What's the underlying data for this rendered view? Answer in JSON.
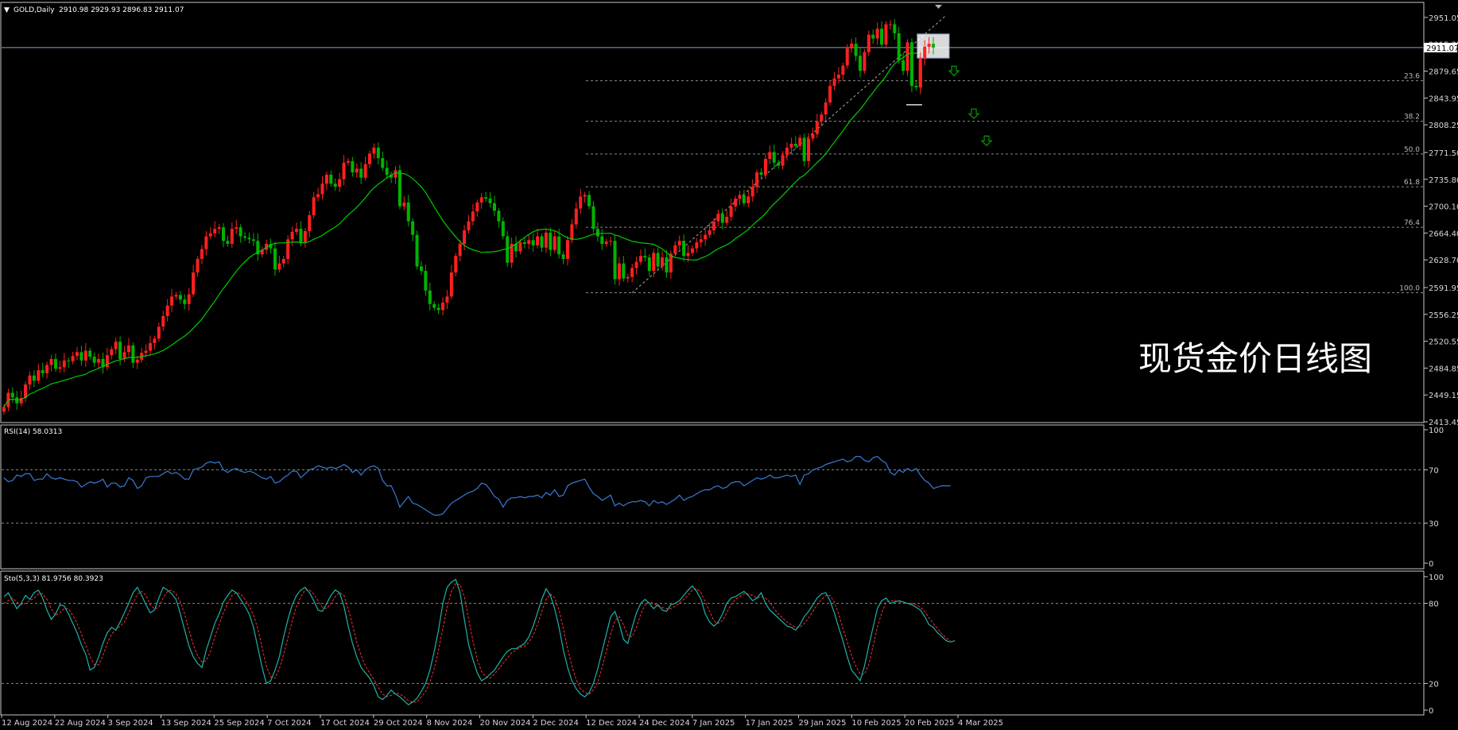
{
  "header": {
    "symbol": "GOLD,Daily",
    "ohlc": "2910.98 2929.93 2896.83 2911.07",
    "current_price": "2911.07"
  },
  "colors": {
    "background": "#000000",
    "up_candle": "#ff2020",
    "down_candle": "#00b400",
    "ma_line": "#00cc00",
    "rsi_line": "#3a7bd5",
    "sto_main": "#20b2aa",
    "sto_signal": "#ff3030",
    "grid_dotted": "#8a8a8a",
    "arrow": "#00a000"
  },
  "watermark": "现货金价日线图",
  "chart_data": [
    {
      "type": "candlestick",
      "title": "GOLD,Daily",
      "ylim": [
        2413.45,
        2970
      ],
      "y_ticks": [
        "2951.05",
        "2915.35",
        "2879.65",
        "2843.95",
        "2808.25",
        "2771.50",
        "2735.80",
        "2700.10",
        "2664.40",
        "2628.70",
        "2591.95",
        "2556.25",
        "2520.55",
        "2484.85",
        "2449.15",
        "2413.45"
      ],
      "x_ticks": [
        "12 Aug 2024",
        "22 Aug 2024",
        "3 Sep 2024",
        "13 Sep 2024",
        "25 Sep 2024",
        "7 Oct 2024",
        "17 Oct 2024",
        "29 Oct 2024",
        "8 Nov 2024",
        "20 Nov 2024",
        "2 Dec 2024",
        "12 Dec 2024",
        "24 Dec 2024",
        "7 Jan 2025",
        "17 Jan 2025",
        "29 Jan 2025",
        "10 Feb 2025",
        "20 Feb 2025",
        "4 Mar 2025"
      ],
      "fibonacci_levels": [
        "23.6",
        "38.2",
        "50.0",
        "61.8",
        "76.4",
        "100.0"
      ],
      "fibonacci_high": 2954,
      "fibonacci_low": 2585,
      "moving_average": "green",
      "close": [
        2433,
        2452,
        2446,
        2438,
        2445,
        2463,
        2475,
        2468,
        2482,
        2478,
        2489,
        2497,
        2484,
        2486,
        2495,
        2494,
        2501,
        2506,
        2495,
        2508,
        2500,
        2492,
        2497,
        2486,
        2502,
        2510,
        2520,
        2497,
        2506,
        2515,
        2492,
        2496,
        2505,
        2508,
        2518,
        2524,
        2540,
        2554,
        2568,
        2580,
        2582,
        2576,
        2570,
        2583,
        2612,
        2630,
        2643,
        2660,
        2664,
        2670,
        2672,
        2654,
        2650,
        2670,
        2672,
        2660,
        2658,
        2656,
        2654,
        2636,
        2642,
        2650,
        2644,
        2616,
        2624,
        2630,
        2656,
        2666,
        2670,
        2652,
        2667,
        2688,
        2712,
        2716,
        2730,
        2742,
        2730,
        2726,
        2736,
        2758,
        2760,
        2745,
        2750,
        2738,
        2756,
        2770,
        2778,
        2764,
        2751,
        2742,
        2738,
        2748,
        2700,
        2705,
        2680,
        2662,
        2620,
        2614,
        2588,
        2570,
        2565,
        2562,
        2572,
        2580,
        2612,
        2634,
        2650,
        2668,
        2680,
        2693,
        2705,
        2712,
        2710,
        2704,
        2694,
        2680,
        2660,
        2625,
        2650,
        2640,
        2652,
        2650,
        2655,
        2648,
        2660,
        2645,
        2665,
        2642,
        2660,
        2636,
        2630,
        2655,
        2676,
        2697,
        2713,
        2715,
        2700,
        2670,
        2660,
        2650,
        2653,
        2654,
        2603,
        2624,
        2604,
        2606,
        2618,
        2626,
        2634,
        2632,
        2614,
        2638,
        2620,
        2632,
        2612,
        2637,
        2648,
        2654,
        2634,
        2638,
        2644,
        2652,
        2656,
        2662,
        2668,
        2680,
        2690,
        2678,
        2686,
        2700,
        2710,
        2715,
        2704,
        2713,
        2726,
        2745,
        2742,
        2763,
        2772,
        2758,
        2754,
        2768,
        2778,
        2783,
        2780,
        2791,
        2760,
        2790,
        2796,
        2813,
        2822,
        2838,
        2860,
        2870,
        2875,
        2887,
        2910,
        2916,
        2900,
        2880,
        2905,
        2928,
        2923,
        2936,
        2915,
        2942,
        2942,
        2930,
        2894,
        2880,
        2918,
        2860,
        2858,
        2896,
        2912,
        2916,
        2911
      ]
    },
    {
      "type": "line",
      "title": "RSI(14) 58.0313",
      "ylim": [
        0,
        100
      ],
      "levels": [
        30,
        70
      ],
      "y_ticks": [
        "100",
        "70",
        "30",
        "0"
      ],
      "values": [
        64,
        61,
        62,
        66,
        65,
        67,
        67,
        62,
        63,
        63,
        67,
        64,
        63,
        64,
        63,
        62,
        62,
        61,
        57,
        59,
        61,
        60,
        61,
        63,
        57,
        60,
        60,
        57,
        58,
        64,
        62,
        56,
        58,
        64,
        65,
        65,
        65,
        67,
        69,
        67,
        68,
        66,
        63,
        63,
        70,
        71,
        72,
        75,
        76,
        75,
        76,
        70,
        68,
        70,
        71,
        69,
        68,
        69,
        68,
        66,
        64,
        63,
        65,
        60,
        61,
        64,
        66,
        69,
        69,
        64,
        67,
        70,
        71,
        73,
        72,
        71,
        72,
        71,
        72,
        74,
        72,
        68,
        70,
        66,
        70,
        72,
        73,
        71,
        62,
        58,
        58,
        51,
        42,
        46,
        50,
        45,
        44,
        42,
        40,
        38,
        36,
        36,
        37,
        41,
        45,
        47,
        49,
        51,
        53,
        54,
        56,
        60,
        59,
        55,
        50,
        48,
        42,
        47,
        49,
        49,
        50,
        49,
        50,
        50,
        51,
        49,
        53,
        51,
        55,
        50,
        51,
        58,
        60,
        61,
        62,
        63,
        57,
        52,
        50,
        47,
        49,
        51,
        43,
        45,
        43,
        45,
        46,
        46,
        47,
        46,
        43,
        47,
        45,
        46,
        44,
        46,
        48,
        51,
        47,
        49,
        50,
        52,
        54,
        55,
        55,
        57,
        58,
        56,
        57,
        60,
        61,
        61,
        58,
        60,
        62,
        64,
        63,
        64,
        66,
        64,
        64,
        65,
        66,
        65,
        66,
        59,
        66,
        67,
        70,
        71,
        72,
        74,
        75,
        76,
        77,
        78,
        76,
        77,
        80,
        80,
        77,
        76,
        79,
        80,
        77,
        75,
        68,
        66,
        70,
        68,
        71,
        69,
        71,
        66,
        62,
        60,
        56,
        57,
        58,
        58,
        58
      ]
    },
    {
      "type": "line",
      "title": "Sto(5,3,3) 81.9756 80.3923",
      "ylim": [
        0,
        100
      ],
      "levels": [
        20,
        80
      ],
      "y_ticks": [
        "100",
        "80",
        "20",
        "0"
      ],
      "series": [
        {
          "name": "main",
          "values": [
            85,
            88,
            82,
            76,
            80,
            86,
            83,
            88,
            90,
            84,
            75,
            68,
            72,
            79,
            78,
            72,
            65,
            58,
            49,
            42,
            30,
            32,
            40,
            50,
            58,
            62,
            60,
            66,
            73,
            80,
            88,
            92,
            86,
            79,
            73,
            75,
            84,
            92,
            90,
            87,
            83,
            72,
            60,
            48,
            40,
            35,
            32,
            45,
            55,
            65,
            72,
            81,
            86,
            90,
            88,
            83,
            78,
            72,
            62,
            47,
            32,
            20,
            22,
            30,
            40,
            55,
            68,
            79,
            86,
            90,
            92,
            88,
            82,
            75,
            74,
            80,
            86,
            90,
            88,
            78,
            63,
            50,
            40,
            32,
            28,
            24,
            18,
            10,
            8,
            11,
            15,
            12,
            10,
            7,
            4,
            6,
            9,
            14,
            20,
            30,
            44,
            60,
            80,
            92,
            96,
            98,
            88,
            68,
            49,
            38,
            28,
            22,
            24,
            27,
            30,
            35,
            40,
            44,
            46,
            46,
            48,
            50,
            55,
            63,
            73,
            83,
            91,
            86,
            76,
            62,
            45,
            32,
            22,
            16,
            12,
            10,
            13,
            20,
            31,
            44,
            57,
            70,
            74,
            65,
            53,
            50,
            62,
            73,
            80,
            83,
            80,
            76,
            79,
            75,
            74,
            79,
            80,
            82,
            86,
            90,
            93,
            89,
            83,
            72,
            66,
            63,
            66,
            72,
            80,
            84,
            85,
            87,
            89,
            86,
            82,
            84,
            88,
            80,
            75,
            72,
            69,
            66,
            63,
            62,
            60,
            64,
            70,
            74,
            79,
            84,
            87,
            88,
            82,
            73,
            62,
            52,
            40,
            30,
            26,
            22,
            33,
            48,
            62,
            76,
            82,
            84,
            80,
            81,
            82,
            81,
            80,
            79,
            77,
            75,
            70,
            64,
            62,
            58,
            55,
            52,
            51,
            52
          ]
        },
        {
          "name": "signal",
          "values": [
            80,
            82,
            84,
            81,
            79,
            80,
            82,
            84,
            87,
            87,
            83,
            76,
            71,
            73,
            76,
            76,
            71,
            65,
            57,
            49,
            40,
            34,
            34,
            41,
            50,
            57,
            60,
            63,
            66,
            73,
            80,
            87,
            89,
            86,
            79,
            76,
            77,
            84,
            89,
            90,
            87,
            81,
            72,
            60,
            49,
            41,
            36,
            37,
            44,
            55,
            64,
            73,
            80,
            86,
            88,
            87,
            83,
            78,
            71,
            61,
            47,
            33,
            25,
            24,
            31,
            42,
            54,
            67,
            78,
            85,
            90,
            90,
            87,
            82,
            77,
            76,
            80,
            85,
            88,
            86,
            76,
            64,
            51,
            41,
            33,
            28,
            23,
            17,
            12,
            10,
            11,
            13,
            12,
            10,
            7,
            6,
            6,
            10,
            14,
            21,
            31,
            45,
            61,
            77,
            89,
            95,
            94,
            85,
            68,
            52,
            38,
            29,
            25,
            24,
            27,
            31,
            35,
            39,
            43,
            45,
            47,
            48,
            51,
            56,
            64,
            74,
            83,
            87,
            84,
            75,
            61,
            46,
            33,
            23,
            16,
            13,
            12,
            15,
            21,
            32,
            44,
            57,
            67,
            70,
            64,
            56,
            55,
            62,
            72,
            79,
            81,
            80,
            78,
            77,
            76,
            76,
            78,
            80,
            83,
            86,
            90,
            91,
            88,
            81,
            74,
            67,
            65,
            67,
            73,
            79,
            83,
            85,
            87,
            87,
            86,
            84,
            85,
            84,
            81,
            76,
            72,
            69,
            66,
            64,
            62,
            62,
            65,
            69,
            74,
            79,
            83,
            86,
            86,
            81,
            72,
            61,
            51,
            41,
            33,
            27,
            27,
            34,
            48,
            62,
            73,
            81,
            82,
            82,
            81,
            81,
            80,
            80,
            79,
            77,
            74,
            69,
            65,
            61,
            57,
            54,
            52
          ]
        }
      ]
    }
  ]
}
